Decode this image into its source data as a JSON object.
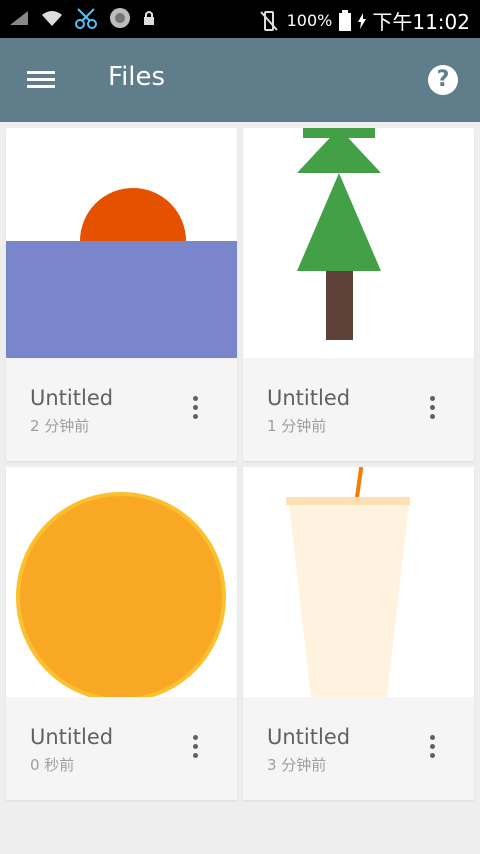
{
  "statusbar": {
    "battery": "100%",
    "time": "下午11:02"
  },
  "appbar": {
    "title": "Files"
  },
  "files": [
    {
      "name": "Untitled",
      "time": "2 分钟前"
    },
    {
      "name": "Untitled",
      "time": "1 分钟前"
    },
    {
      "name": "Untitled",
      "time": "0 秒前"
    },
    {
      "name": "Untitled",
      "time": "3 分钟前"
    }
  ],
  "colors": {
    "appbar": "#607d8b",
    "sun": "#e65100",
    "sea": "#7986cb",
    "tree_leaves": "#43a047",
    "tree_trunk": "#5d4037",
    "orange_circle": "#f9a825",
    "cup": "#fff3e0",
    "straw": "#f57c00"
  }
}
